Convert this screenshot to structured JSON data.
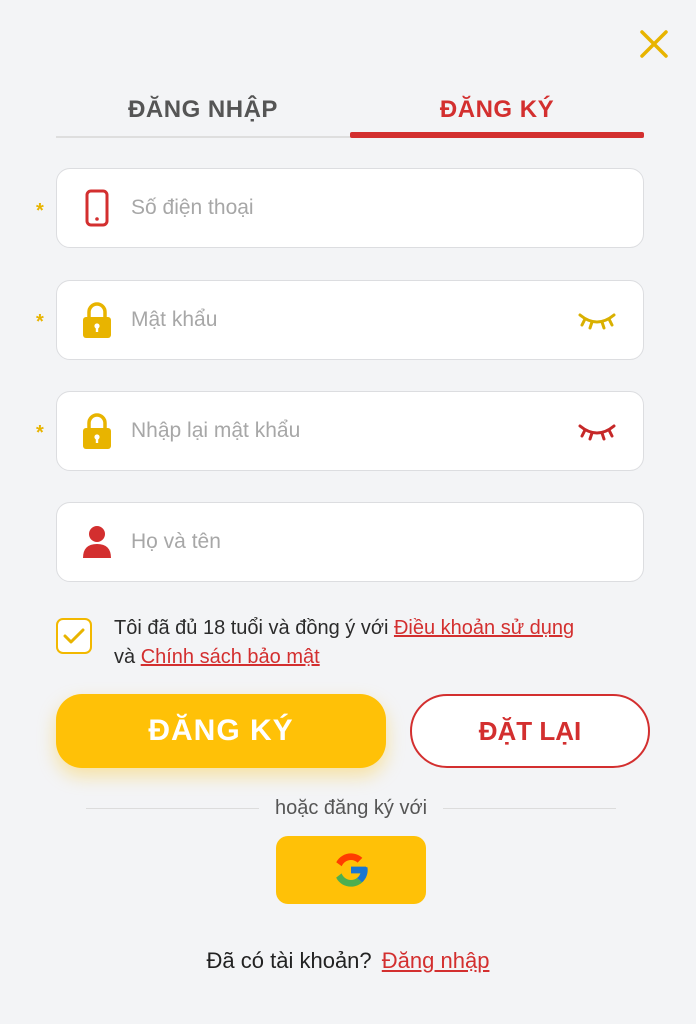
{
  "tabs": {
    "login_label": "ĐĂNG NHẬP",
    "register_label": "ĐĂNG KÝ",
    "active": "register"
  },
  "form": {
    "phone": {
      "placeholder": "Số điện thoại",
      "value": "",
      "required_mark": "*",
      "icon": "phone-icon"
    },
    "password": {
      "placeholder": "Mật khẩu",
      "value": "",
      "required_mark": "*",
      "icon": "lock-icon",
      "eye_color": "#d9b000"
    },
    "confirm_password": {
      "placeholder": "Nhập lại mật khẩu",
      "value": "",
      "required_mark": "*",
      "icon": "lock-icon",
      "eye_color": "#c62828"
    },
    "full_name": {
      "placeholder": "Họ và tên",
      "value": "",
      "icon": "user-icon"
    }
  },
  "agreement": {
    "checked": true,
    "text_before": "Tôi đã đủ 18 tuổi và đồng ý với ",
    "terms_link": "Điều khoản sử dụng",
    "text_and": "và ",
    "privacy_link": "Chính sách bảo mật"
  },
  "buttons": {
    "register": "ĐĂNG KÝ",
    "reset": "ĐẶT LẠI"
  },
  "social": {
    "divider_text": "hoặc đăng ký với",
    "google_icon": "google-icon"
  },
  "footer": {
    "question": "Đã có tài khoản?",
    "login_link": "Đăng nhập"
  },
  "colors": {
    "primary": "#ffc107",
    "accent_red": "#d32f2f",
    "icon_gold": "#e8b400"
  }
}
